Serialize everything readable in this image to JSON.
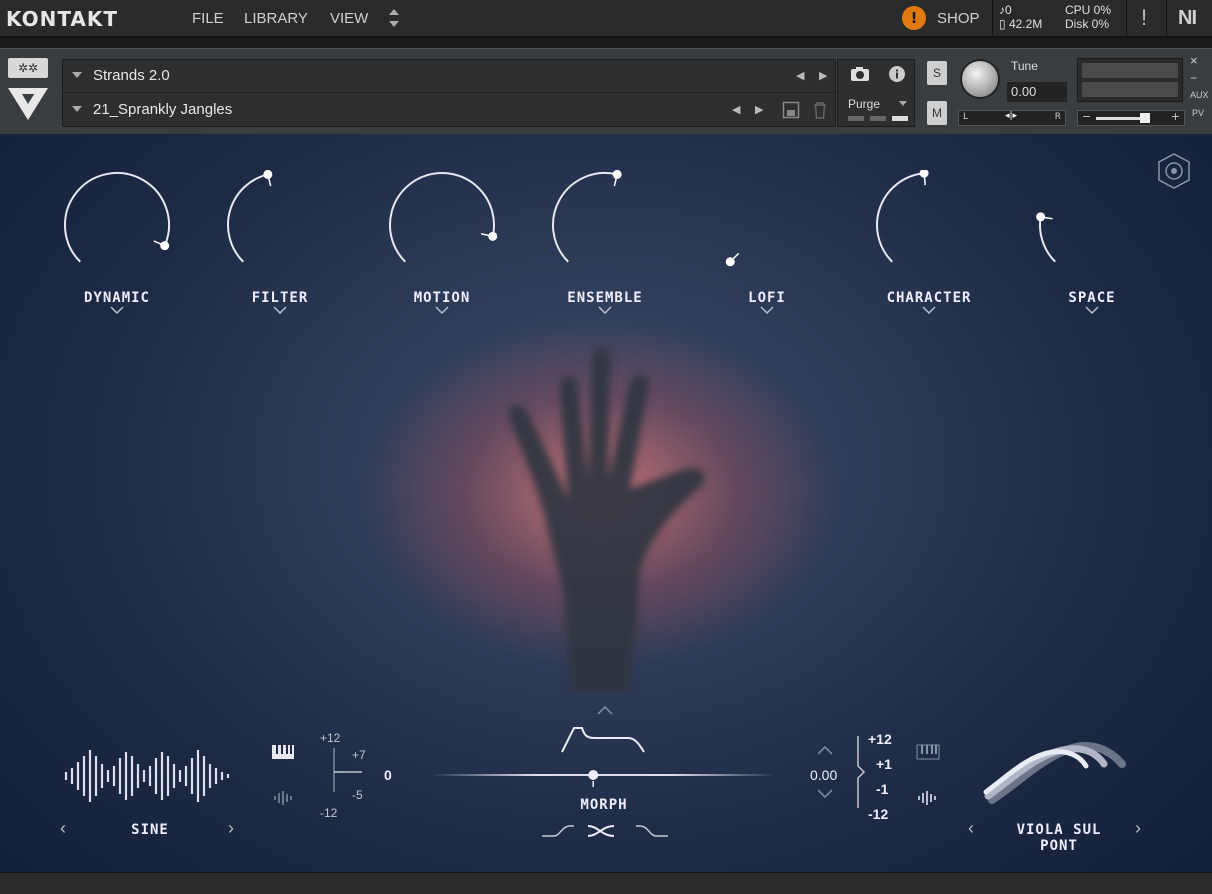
{
  "app": {
    "logo": "KONTAKT",
    "menu": [
      "FILE",
      "LIBRARY",
      "VIEW"
    ],
    "shop": "SHOP",
    "shop_badge": "!",
    "midi_label": "0",
    "memory": "42.2M",
    "cpu": "CPU 0%",
    "disk": "Disk 0%",
    "warning": "!",
    "ni_logo": "NI"
  },
  "instrument": {
    "library_name": "Strands 2.0",
    "preset_name": "21_Sprankly Jangles",
    "purge": "Purge",
    "solo": "S",
    "mute": "M",
    "tune_label": "Tune",
    "tune_value": "0.00",
    "pan_left": "L",
    "pan_right": "R",
    "vol_minus": "−",
    "vol_plus": "+",
    "side_close": "×",
    "side_min": "−",
    "side_aux": "AUX",
    "side_pv": "PV"
  },
  "macros": [
    {
      "label": "DYNAMIC",
      "level": 0.92
    },
    {
      "label": "FILTER",
      "level": 0.45
    },
    {
      "label": "MOTION",
      "level": 0.88
    },
    {
      "label": "ENSEMBLE",
      "level": 0.55
    },
    {
      "label": "LOFI",
      "level": 0.0
    },
    {
      "label": "CHARACTER",
      "level": 0.48
    },
    {
      "label": "SPACE",
      "level": 0.2
    }
  ],
  "layer_a": {
    "name": "SINE",
    "pitch_top": "+12",
    "pitch_plus7": "+7",
    "pitch_minus5": "-5",
    "pitch_bottom": "-12",
    "pitch_value": "0"
  },
  "morph": {
    "label": "MORPH",
    "position": 0.47
  },
  "layer_b": {
    "name": "VIOLA SUL PONT",
    "fine_value": "0.00",
    "oct_plus12": "+12",
    "oct_plus1": "+1",
    "oct_minus1": "-1",
    "oct_minus12": "-12"
  },
  "colors": {
    "topbar": "#2a2a2a",
    "header": "#3a3d40",
    "accent_orange": "#e07a10",
    "glow": "#d87878",
    "bg_blue": "#1d2a44"
  }
}
